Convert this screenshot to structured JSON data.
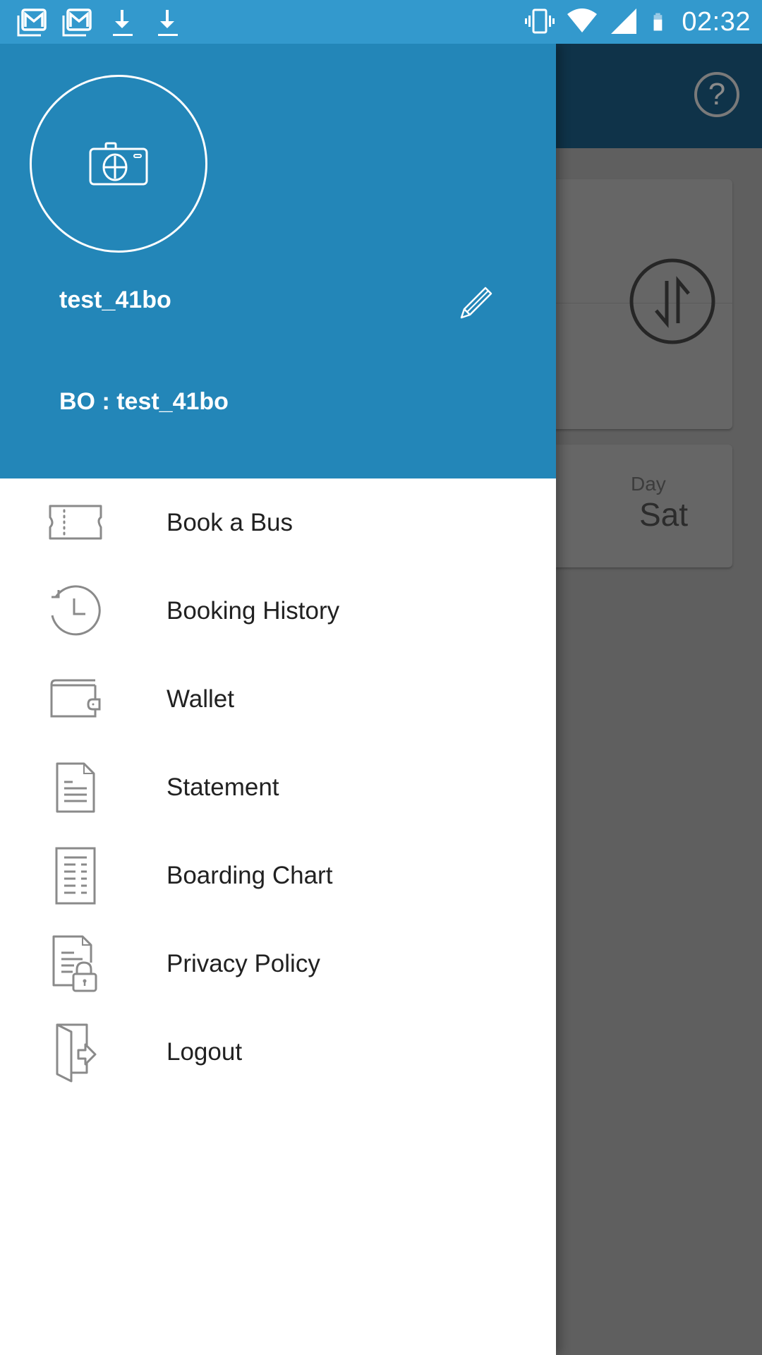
{
  "status_bar": {
    "notification_icons": [
      "gmail-icon",
      "gmail-icon",
      "download-icon",
      "download-icon"
    ],
    "system_icons": [
      "vibrate-icon",
      "wifi-icon",
      "signal-icon",
      "battery-icon"
    ],
    "time": "02:32"
  },
  "background_app": {
    "help_icon": "?",
    "day_label": "Day",
    "day_value": "Sat"
  },
  "drawer": {
    "header": {
      "username": "test_41bo",
      "bo_line": "BO : test_41bo",
      "avatar_icon": "camera-add-icon",
      "edit_icon": "pencil-icon"
    },
    "menu": [
      {
        "label": "Book a Bus",
        "icon": "ticket-icon"
      },
      {
        "label": "Booking History",
        "icon": "history-icon"
      },
      {
        "label": "Wallet",
        "icon": "wallet-icon"
      },
      {
        "label": "Statement",
        "icon": "document-icon"
      },
      {
        "label": "Boarding Chart",
        "icon": "list-document-icon"
      },
      {
        "label": "Privacy Policy",
        "icon": "document-lock-icon"
      },
      {
        "label": "Logout",
        "icon": "logout-door-icon"
      }
    ]
  },
  "colors": {
    "status_bar": "#3399cd",
    "drawer_header": "#2386b8",
    "app_bar": "#0f3349",
    "scrim": "#5f5f5f",
    "menu_text": "#212121",
    "icon_gray": "#8a8a8a"
  }
}
